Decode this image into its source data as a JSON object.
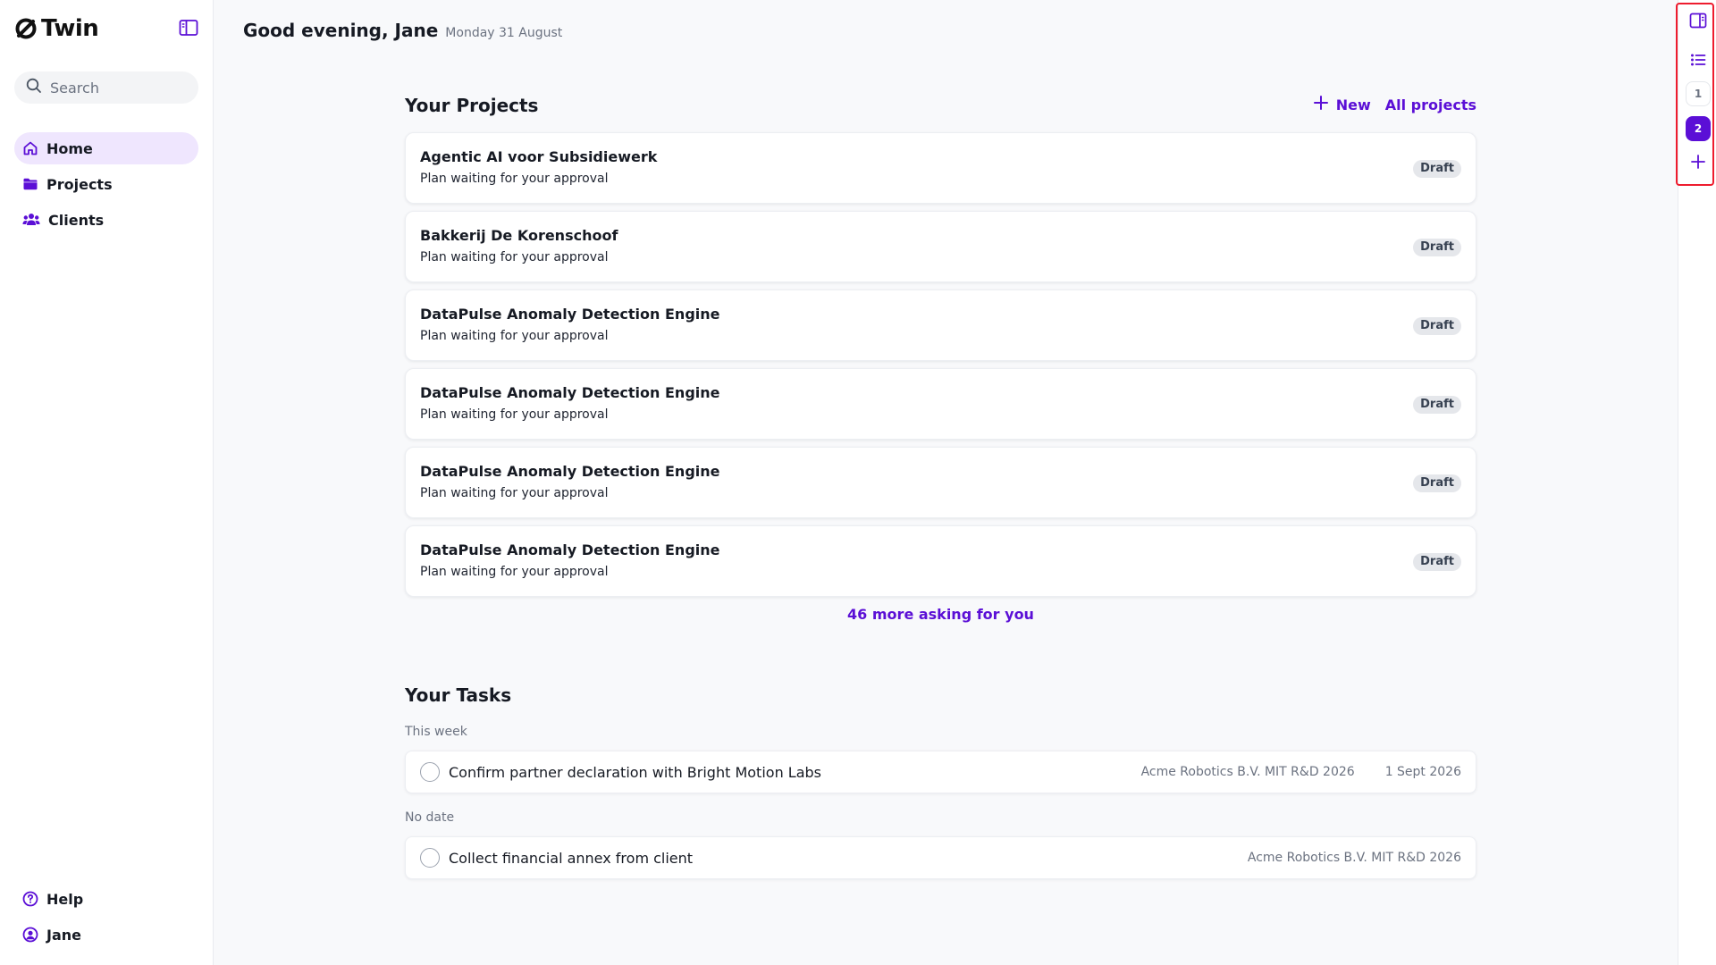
{
  "app": {
    "logo_text": "Twin"
  },
  "sidebar": {
    "search_placeholder": "Search",
    "nav": [
      {
        "label": "Home"
      },
      {
        "label": "Projects"
      },
      {
        "label": "Clients"
      }
    ],
    "footer": [
      {
        "label": "Help"
      },
      {
        "label": "Jane"
      }
    ]
  },
  "header": {
    "greeting": "Good evening, Jane",
    "date": "Monday 31 August"
  },
  "projects": {
    "title": "Your Projects",
    "new_label": "New",
    "all_label": "All projects",
    "items": [
      {
        "name": "Agentic AI voor Subsidiewerk",
        "status": "Plan waiting for your approval",
        "badge": "Draft"
      },
      {
        "name": "Bakkerij De Korenschoof",
        "status": "Plan waiting for your approval",
        "badge": "Draft"
      },
      {
        "name": "DataPulse Anomaly Detection Engine",
        "status": "Plan waiting for your approval",
        "badge": "Draft"
      },
      {
        "name": "DataPulse Anomaly Detection Engine",
        "status": "Plan waiting for your approval",
        "badge": "Draft"
      },
      {
        "name": "DataPulse Anomaly Detection Engine",
        "status": "Plan waiting for your approval",
        "badge": "Draft"
      },
      {
        "name": "DataPulse Anomaly Detection Engine",
        "status": "Plan waiting for your approval",
        "badge": "Draft"
      }
    ],
    "more_label": "46 more asking for you"
  },
  "tasks": {
    "title": "Your Tasks",
    "groups": [
      {
        "label": "This week",
        "items": [
          {
            "title": "Confirm partner declaration with Bright Motion Labs",
            "project": "Acme Robotics B.V. MIT R&D 2026",
            "due": "1 Sept 2026"
          }
        ]
      },
      {
        "label": "No date",
        "items": [
          {
            "title": "Collect financial annex from client",
            "project": "Acme Robotics B.V. MIT R&D 2026",
            "due": ""
          }
        ]
      }
    ]
  },
  "rail": {
    "tab_1": "1",
    "tab_2": "2"
  },
  "colors": {
    "accent": "#5b0fd6",
    "active_nav_bg": "#efe6fe",
    "highlight_box": "#ee1c2e",
    "badge_bg": "#e5e7eb"
  }
}
